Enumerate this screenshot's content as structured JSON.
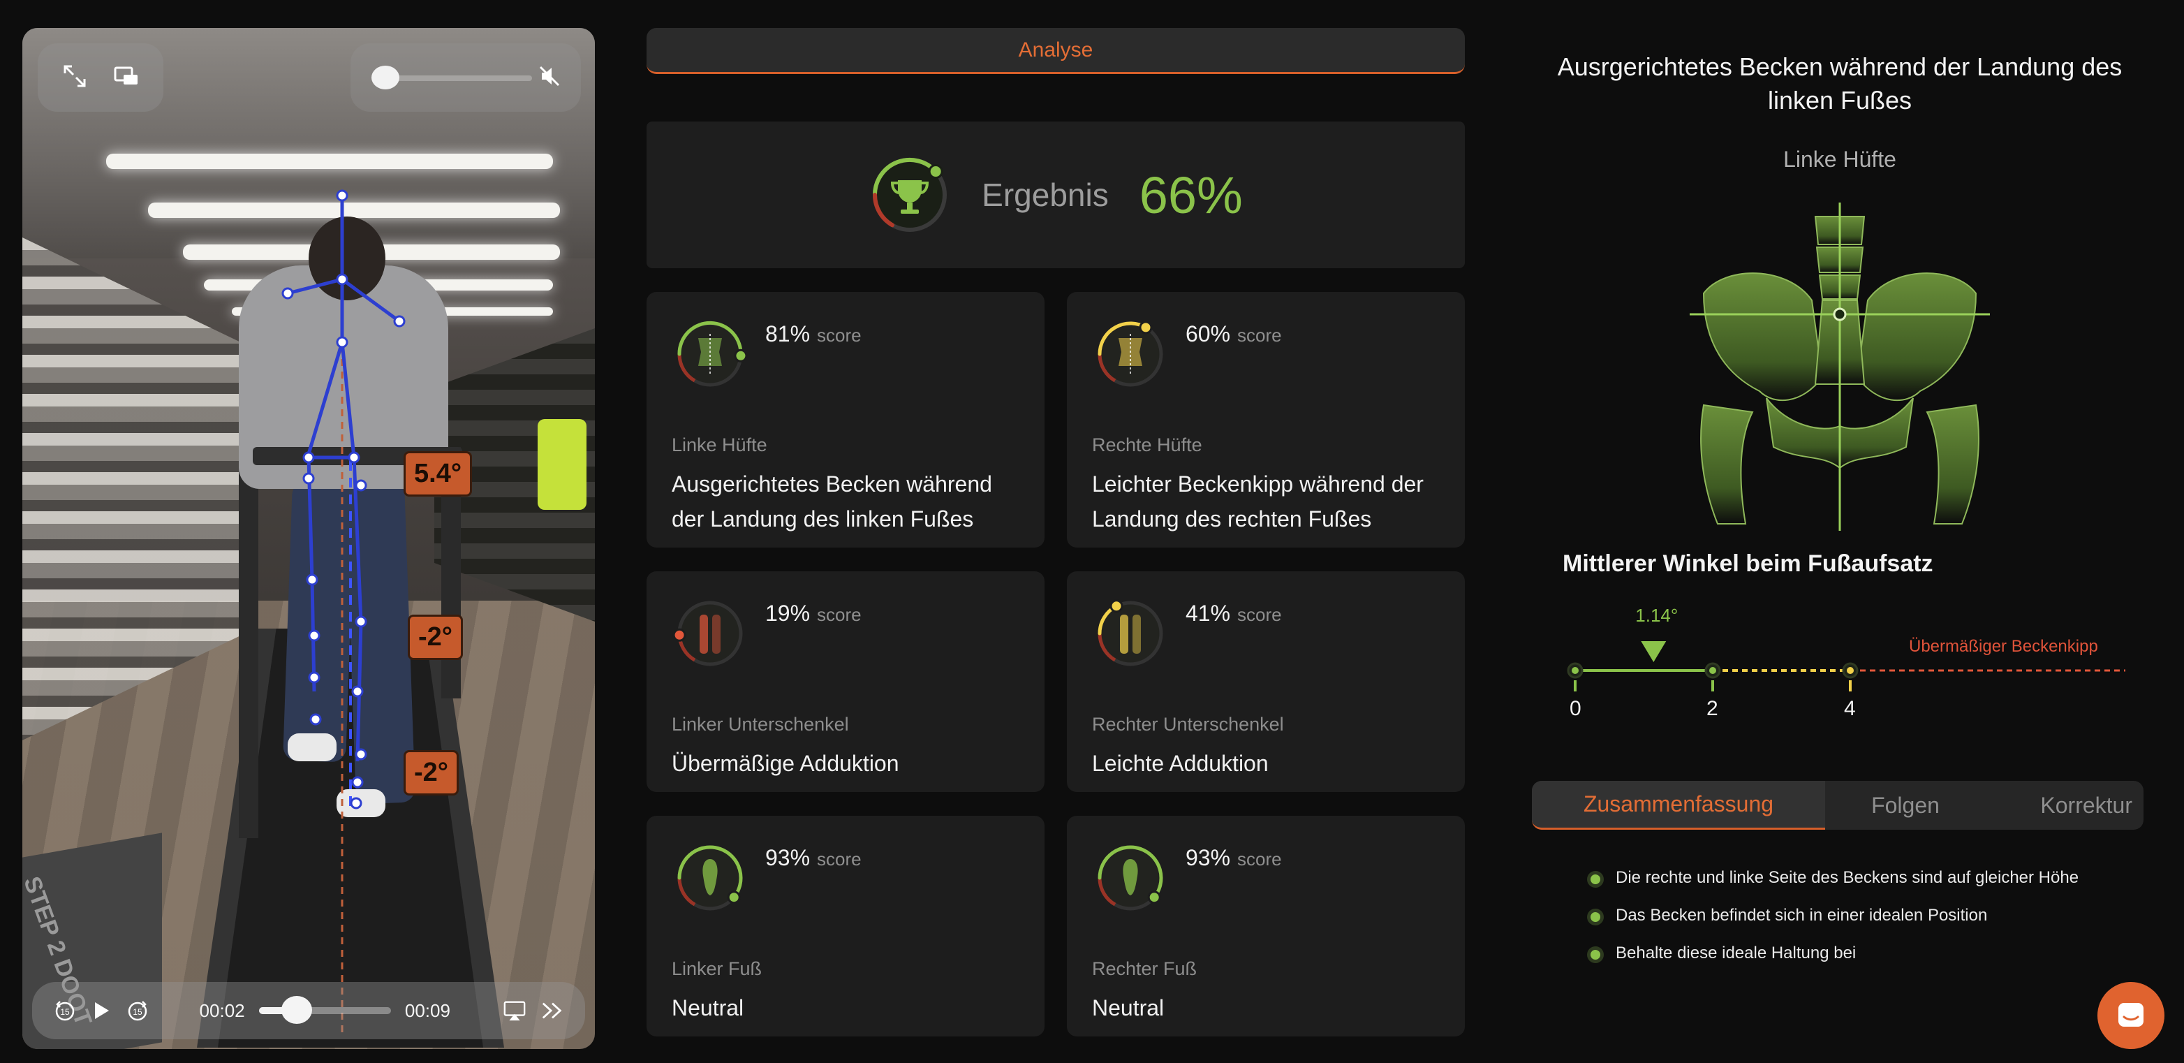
{
  "video": {
    "angle_tags": [
      "5.4°",
      "-2°",
      "-2°"
    ],
    "mat_text": "STEP 2  DOOT",
    "current_time": "00:02",
    "duration": "00:09",
    "progress": 0.25,
    "volume": 0.05,
    "icons": [
      "fullscreen-icon",
      "picture-in-picture-icon",
      "mute-icon",
      "rewind-15-icon",
      "play-icon",
      "forward-15-icon",
      "airplay-icon",
      "skip-forward-icon"
    ]
  },
  "analyse_tab": {
    "label": "Analyse"
  },
  "result": {
    "label": "Ergebnis",
    "value": "66%",
    "score": 0.66
  },
  "cards": [
    {
      "pct": "81%",
      "score_label": "score",
      "category": "Linke Hüfte",
      "description": "Ausgerichtetes Becken während der Landung des linken Fußes",
      "score": 0.81,
      "color": "#8bc34a",
      "icon": "pelvis-icon"
    },
    {
      "pct": "60%",
      "score_label": "score",
      "category": "Rechte Hüfte",
      "description": "Leichter Beckenkipp während der Landung des rechten Fußes",
      "score": 0.6,
      "color": "#f2d14a",
      "icon": "pelvis-icon"
    },
    {
      "pct": "19%",
      "score_label": "score",
      "category": "Linker Unterschenkel",
      "description": "Übermäßige Adduktion",
      "score": 0.19,
      "color": "#e2573a",
      "icon": "leg-icon"
    },
    {
      "pct": "41%",
      "score_label": "score",
      "category": "Rechter Unterschenkel",
      "description": "Leichte Adduktion",
      "score": 0.41,
      "color": "#f2d14a",
      "icon": "leg-icon"
    },
    {
      "pct": "93%",
      "score_label": "score",
      "category": "Linker Fuß",
      "description": "Neutral",
      "score": 0.93,
      "color": "#8bc34a",
      "icon": "foot-icon"
    },
    {
      "pct": "93%",
      "score_label": "score",
      "category": "Rechter Fuß",
      "description": "Neutral",
      "score": 0.93,
      "color": "#8bc34a",
      "icon": "foot-icon"
    }
  ],
  "detail": {
    "title": "Ausrgerichtetes Becken während der Landung des linken Fußes",
    "subtitle": "Linke Hüfte",
    "angle_heading": "Mittlerer Winkel beim Fußaufsatz",
    "marker_value": "1.14°",
    "marker_position": 1.14,
    "ticks": [
      "0",
      "2",
      "4"
    ],
    "warning_label": "Übermäßiger Beckenkipp"
  },
  "tabs": [
    {
      "label": "Zusammenfassung",
      "active": true
    },
    {
      "label": "Folgen",
      "active": false
    },
    {
      "label": "Korrektur",
      "active": false
    }
  ],
  "bullets": [
    "Die rechte und linke Seite des Beckens sind auf gleicher Höhe",
    "Das Becken befindet sich in einer idealen Position",
    "Behalte diese ideale Haltung bei"
  ],
  "colors": {
    "accent": "#e36d35",
    "good": "#8bc34a",
    "medium": "#f2d14a",
    "bad": "#e2573a"
  }
}
